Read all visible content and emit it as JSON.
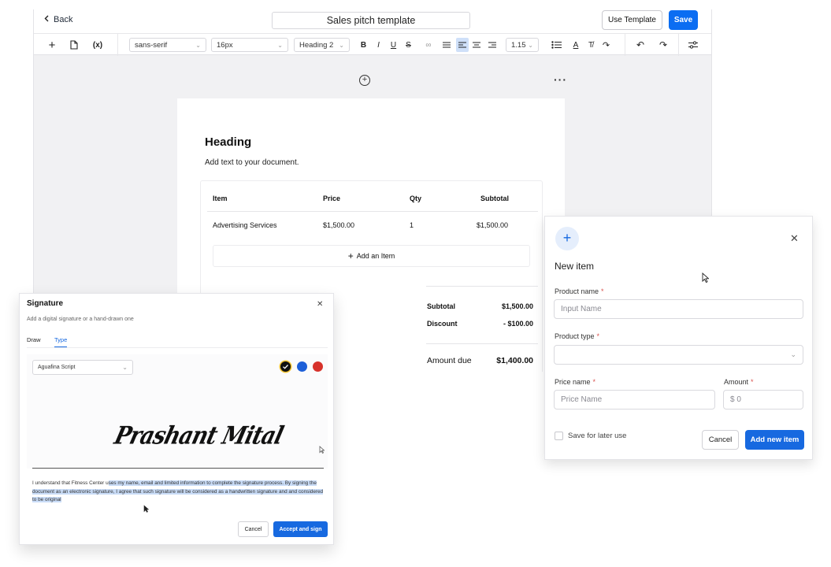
{
  "editor": {
    "back_label": "Back",
    "document_title": "Sales pitch template",
    "use_template_label": "Use Template",
    "save_label": "Save",
    "toolbar": {
      "font_family": "sans-serif",
      "font_size": "16px",
      "block_type": "Heading 2",
      "line_height": "1.15",
      "variable_icon_text": "(x)"
    }
  },
  "document": {
    "heading": "Heading",
    "body_text": "Add text to your document.",
    "table": {
      "headers": [
        "Item",
        "Price",
        "Qty",
        "Subtotal"
      ],
      "rows": [
        {
          "item": "Advertising Services",
          "price": "$1,500.00",
          "qty": "1",
          "subtotal": "$1,500.00"
        }
      ],
      "add_item_label": "Add an Item"
    },
    "summary": {
      "subtotal_label": "Subtotal",
      "subtotal_value": "$1,500.00",
      "discount_label": "Discount",
      "discount_value": "- $100.00",
      "amount_due_label": "Amount due",
      "amount_due_value": "$1,400.00"
    }
  },
  "new_item": {
    "title": "New item",
    "product_name_label": "Product name",
    "product_name_placeholder": "Input Name",
    "product_type_label": "Product type",
    "price_name_label": "Price name",
    "price_name_placeholder": "Price Name",
    "amount_label": "Amount",
    "amount_placeholder": "$ 0",
    "required_mark": "*",
    "save_later_label": "Save for later use",
    "cancel_label": "Cancel",
    "add_label": "Add new item"
  },
  "signature": {
    "title": "Signature",
    "subtitle": "Add a digital signature or a hand-drawn one",
    "tabs": [
      "Draw",
      "Type"
    ],
    "active_tab": "Type",
    "font": "Aguafina Script",
    "colors": [
      "#111111",
      "#1d5fd8",
      "#d7322b"
    ],
    "selected_color": "#111111",
    "typed_name": "Prashant Mital",
    "consent_plain": "I understand that Fitness Center u",
    "consent_highlighted": "ses my name, email and limited information to complete the signature process. By signing the document as an electronic signature, I agree that such signature will be considered as a handwritten signature and and considered to be original",
    "cancel_label": "Cancel",
    "accept_label": "Accept and sign"
  }
}
